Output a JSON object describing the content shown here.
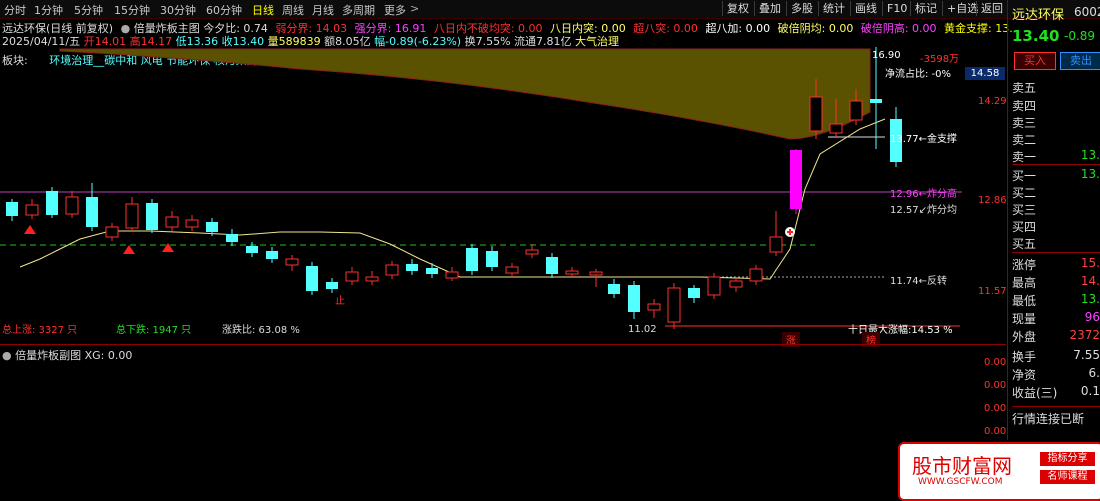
{
  "toolbar": {
    "periods": [
      "分时",
      "1分钟",
      "5分钟",
      "15分钟",
      "30分钟",
      "60分钟",
      "日线",
      "周线",
      "月线",
      "多周期",
      "更多"
    ],
    "active_period": "日线",
    "right_buttons": [
      "复权",
      "叠加",
      "多股",
      "统计",
      "画线",
      "F10",
      "标记",
      "+自选",
      "返回"
    ]
  },
  "header": {
    "stock_name": "远达环保(日线 前复权)",
    "indicator_name": "倍量炸板主图",
    "today_ratio_label": "今夕比:",
    "today_ratio_value": "0.74",
    "weak_boundary": "弱分界: 14.03",
    "strong_boundary": "强分界: 16.91",
    "eight_day_no_break": "八日内不破均突: 0.00",
    "eight_day_break": "八日内突: 0.00",
    "super_eight": "超八突: 0.00",
    "super_eight_add": "超八加: 0.00",
    "double_yin": "破倍阴均: 0.00",
    "double_yin_high": "破倍阴高: 0.00",
    "gold_support": "黄金支撑: 13.",
    "date": "2025/04/11/五",
    "open": "开14.01",
    "high": "高14.17",
    "low": "低13.36",
    "close": "收13.40",
    "volume": "量589839",
    "amount": "额8.05亿",
    "change": "幅-0.89(-6.23%)",
    "turnover": "换7.55%",
    "float_cap": "流通7.81亿",
    "major_treatment": "大气治理",
    "sector_label": "板块:",
    "sector_tags": "环境治理__碳中和 风电 节能环保 核污染防治 与"
  },
  "main_chart": {
    "y_ticks": [
      "14.29",
      "12.86",
      "11.57"
    ],
    "price_marker": "14.58",
    "inflow_label": "16.90",
    "inflow_value": "-3598万",
    "net_flow_ratio": "净流占比: -0%",
    "gold_support_line": "13.77←金支撑",
    "fried_high": "12.96←炸分高",
    "fried_avg": "12.57↙炸分均",
    "reversal": "11.74←反转",
    "low_mark": "11.02",
    "ten_day_gain": "十日最大涨幅:14.53 %",
    "total_up": "总上涨: 3327 只",
    "total_down": "总下跌: 1947 只",
    "up_down_ratio": "涨跌比: 63.08 %",
    "zhang_tag": "涨",
    "bang_tag": "榜",
    "stop_tag": "止"
  },
  "sub_chart": {
    "title": "倍量炸板副图 XG: 0.00",
    "y_ticks": [
      "0.00",
      "0.00",
      "0.00",
      "0.00"
    ]
  },
  "right_panel": {
    "name": "远达环保",
    "code": "6002",
    "price": "13.40",
    "change": "-0.89",
    "buy_button": "买入",
    "sell_button": "卖出",
    "sell_rows": [
      "卖五",
      "卖四",
      "卖三",
      "卖二",
      "卖一"
    ],
    "sell_one_value": "13.",
    "buy_rows": [
      "买一",
      "买二",
      "买三",
      "买四",
      "买五"
    ],
    "buy_one_value": "13.",
    "stats": [
      {
        "k": "涨停",
        "v": "15."
      },
      {
        "k": "最高",
        "v": "14."
      },
      {
        "k": "最低",
        "v": "13."
      },
      {
        "k": "现量",
        "v": "96"
      },
      {
        "k": "外盘",
        "v": "2372"
      },
      {
        "k": "换手",
        "v": "7.55"
      },
      {
        "k": "净资",
        "v": "6."
      },
      {
        "k": "收益(三)",
        "v": "0.1"
      }
    ],
    "status": "行情连接已断"
  },
  "watermark": {
    "title": "股市财富网",
    "tag1": "指标分享",
    "tag2": "名师课程",
    "url": "WWW.GSCFW.COM"
  },
  "colors": {
    "up": "#ff3030",
    "down": "#54ffff",
    "ma": "#f0e68c",
    "hot": "#ff00ff",
    "bg": "#000000"
  }
}
